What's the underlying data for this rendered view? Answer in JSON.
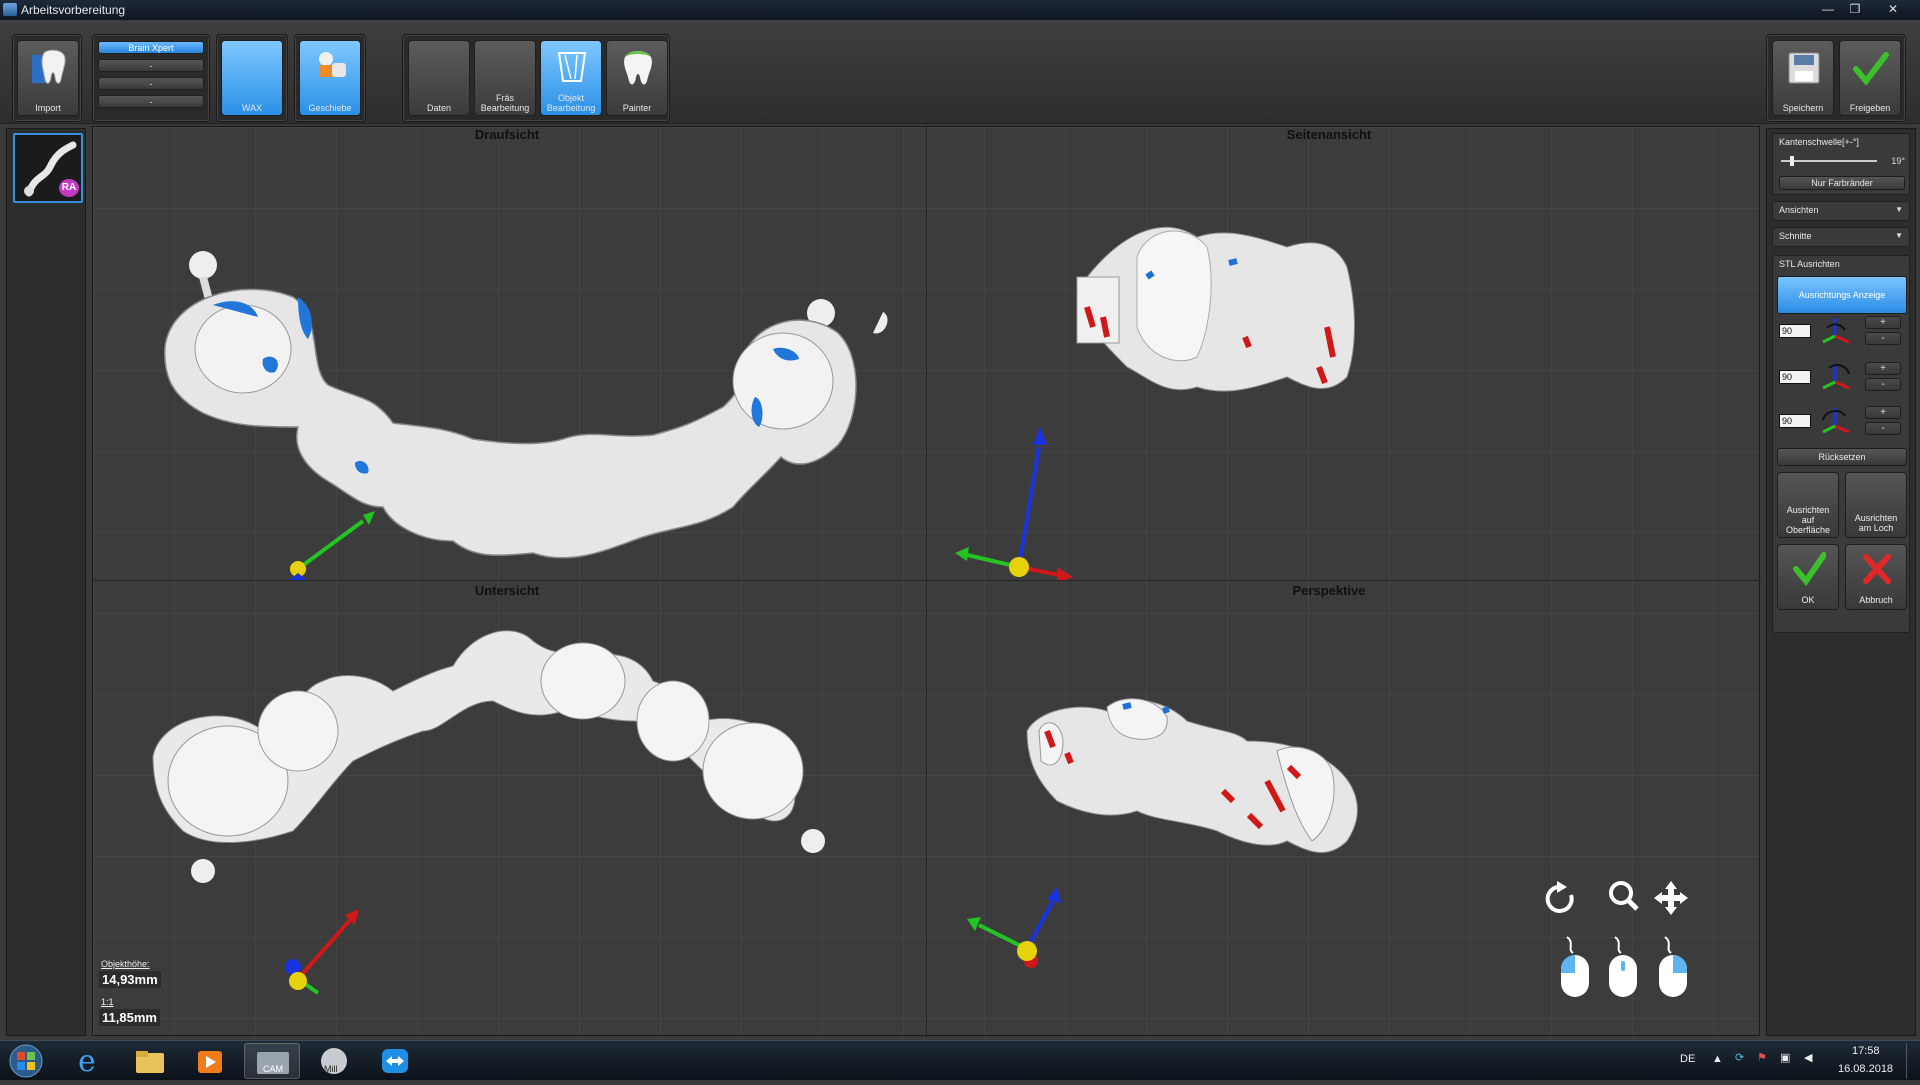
{
  "window": {
    "title": "Arbeitsvorbereitung"
  },
  "toolbar": {
    "import_label": "Import",
    "brain": {
      "active": "Brain Xpert",
      "items": [
        "-",
        "-",
        "-"
      ]
    },
    "wax_label": "WAX",
    "geschiebe_label": "Geschiebe",
    "daten_label": "Daten",
    "fraes_label": "Fräs Bearbeitung",
    "objekt_label": "Objekt Bearbeitung",
    "painter_label": "Painter",
    "speichern_label": "Speichern",
    "freigeben_label": "Freigeben"
  },
  "thumbnail": {
    "badge": "RA"
  },
  "viewports": {
    "top_left": "Draufsicht",
    "top_right": "Seitenansicht",
    "bottom_left": "Untersicht",
    "bottom_right": "Perspektive"
  },
  "measurements": {
    "height_label": "Objekthöhe:",
    "height_value": "14,93mm",
    "scale_label": "1:1",
    "scale_value": "11,85mm"
  },
  "panel": {
    "kanten_label": "Kantenschwelle[+-°]",
    "kanten_value": "19°",
    "kanten_level": 0.1,
    "nur_farbraender": "Nur Farbränder",
    "ansichten": "Ansichten",
    "schnitte": "Schnitte",
    "stl_ausrichten": "STL Ausrichten",
    "ausrichtungs_anzeige": "Ausrichtungs Anzeige",
    "rotations": [
      "90",
      "90",
      "90"
    ],
    "plus": "+",
    "minus": "-",
    "ruecksetzen": "Rücksetzen",
    "ausrichten_oberflaeche": "Ausrichten auf Oberfläche",
    "ausrichten_loch": "Ausrichten am Loch",
    "ok": "OK",
    "abbruch": "Abbruch"
  },
  "taskbar": {
    "language": "DE",
    "time": "17:58",
    "date": "16.08.2018",
    "cam_label": "CAM",
    "mill_label": "Mill"
  },
  "colors": {
    "accent": "#2a8ce4",
    "marker_blue": "#1e6fd6",
    "marker_red": "#d01818"
  }
}
